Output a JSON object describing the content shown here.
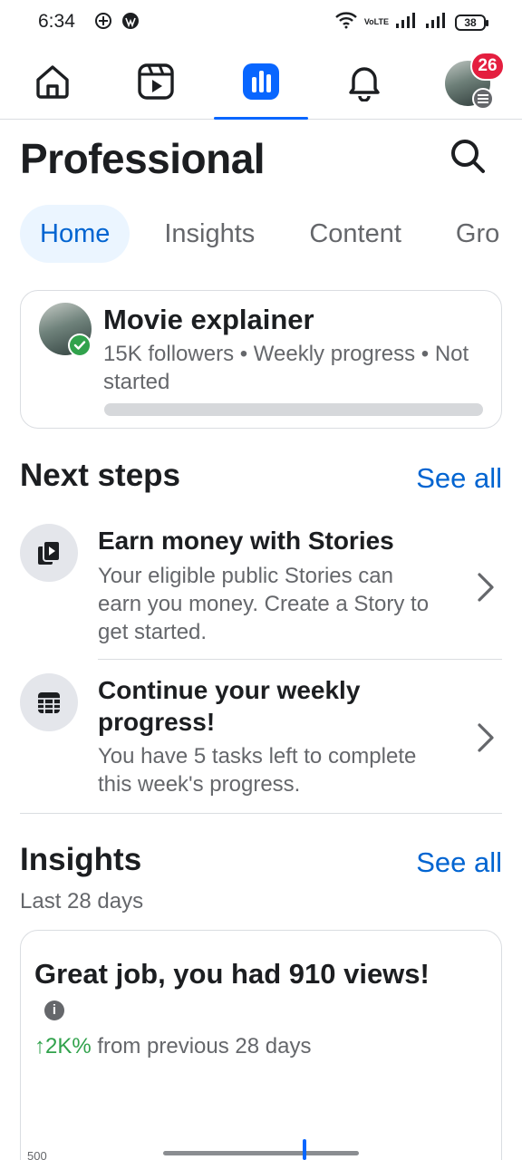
{
  "status_bar": {
    "time": "6:34",
    "network_label": "VoLTE",
    "battery": "38"
  },
  "nav": {
    "notification_count": "26"
  },
  "header": {
    "title": "Professional"
  },
  "tabs": [
    {
      "label": "Home",
      "active": true
    },
    {
      "label": "Insights",
      "active": false
    },
    {
      "label": "Content",
      "active": false
    },
    {
      "label": "Gro",
      "active": false
    }
  ],
  "profile": {
    "name": "Movie explainer",
    "meta": "15K followers • Weekly progress • Not started",
    "progress": 0
  },
  "next_steps": {
    "title": "Next steps",
    "see_all": "See all",
    "items": [
      {
        "icon": "stories-icon",
        "title": "Earn money with Stories",
        "description": "Your eligible public Stories can earn you money. Create a Story to get started."
      },
      {
        "icon": "calendar-icon",
        "title": "Continue your weekly progress!",
        "description": "You have 5 tasks left to complete this week's progress."
      }
    ]
  },
  "insights": {
    "title": "Insights",
    "see_all": "See all",
    "period": "Last 28 days",
    "headline": "Great job, you had 910 views!",
    "change_value": "↑2K%",
    "change_text": " from previous 28 days",
    "y_tick": "500"
  },
  "colors": {
    "accent": "#0866ff",
    "link": "#0064d1",
    "badge": "#e41e3f",
    "positive": "#31a24c"
  }
}
